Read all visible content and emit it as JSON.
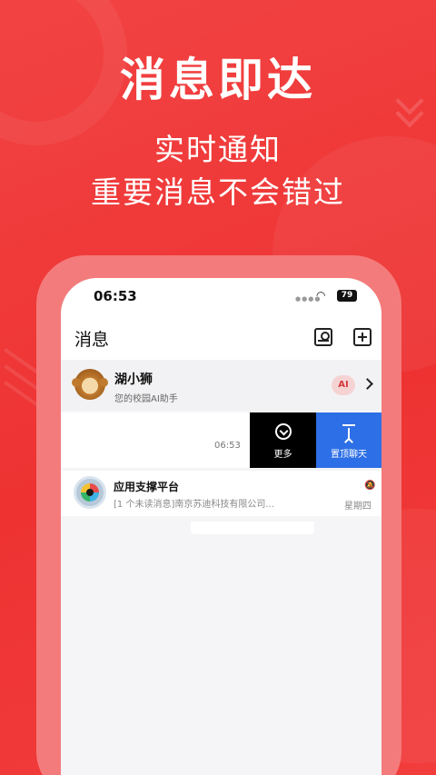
{
  "promo": {
    "headline": "消息即达",
    "subline1": "实时通知",
    "subline2": "重要消息不会错过"
  },
  "status_bar": {
    "time": "06:53",
    "battery": "79"
  },
  "navbar": {
    "title": "消息"
  },
  "conversations": [
    {
      "name": "湖小狮",
      "description": "您的校园AI助手",
      "badge": "AI",
      "avatar": "monkey-avatar"
    },
    {
      "time": "06:53",
      "actions": {
        "more_label": "更多",
        "pin_label": "置顶聊天"
      }
    },
    {
      "name": "应用支撑平台",
      "preview": "[1 个未读消息]南京苏迪科技有限公司...",
      "date": "星期四",
      "avatar": "app-platform-avatar"
    }
  ],
  "colors": {
    "background": "#f0393a",
    "phone_frame": "#f47b7b",
    "pin_button": "#2d6fe6",
    "more_button": "#000000",
    "ai_badge": "#f6d3d3"
  }
}
